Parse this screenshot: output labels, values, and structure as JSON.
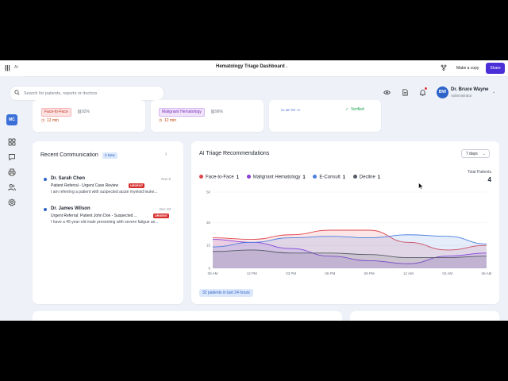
{
  "topbar": {
    "logo": "|||",
    "ai_label": "AI",
    "title": "Hematology Triage Dashboard",
    "title_caret": "⌄",
    "make_copy": "Make a copy",
    "share": "Share"
  },
  "sidebar": {
    "badge": "MC",
    "items": [
      "dashboard",
      "messages",
      "print",
      "patients",
      "settings"
    ]
  },
  "search": {
    "placeholder": "Search for patients, reports or doctors"
  },
  "user": {
    "initials": "BW",
    "name": "Dr. Bruce Wayne",
    "role": "Administrator",
    "caret": "⌄"
  },
  "top_cards": [
    {
      "tag": "Face-to-Face",
      "confidence": "92%",
      "time": "12 min"
    },
    {
      "tag": "Malignant Hematology",
      "confidence": "96%",
      "time": "12 min"
    },
    {
      "mini_tags": "SL  MF  ER  +2",
      "status": "Verified"
    }
  ],
  "communication": {
    "title": "Recent Communication",
    "new_badge": "2 New",
    "messages": [
      {
        "sender": "Dr. Sarah Chen",
        "date": "Nov 8",
        "subject": "Patient Referral - Urgent Case Review",
        "badge": "URGENT",
        "preview": "I am referring a patient with suspected acute myeloid leuke..."
      },
      {
        "sender": "Dr. James Wilson",
        "date": "Dec 20",
        "subject": "Urgent Referral: Patient John Doe - Suspected ...",
        "badge": "URGENT",
        "preview": "I have a 45-year-old male presenting with severe fatigue an..."
      }
    ]
  },
  "triage": {
    "title": "AI Triage Recommendations",
    "range": "7 days",
    "total_label": "Total Patients",
    "total_value": "4",
    "footer": "32 patients in last 24 hours",
    "legend": [
      {
        "name": "Face-to-Face",
        "count": "1",
        "color": "#e0464e"
      },
      {
        "name": "Malignant Hematology",
        "count": "1",
        "color": "#8b3fd9"
      },
      {
        "name": "E-Consult",
        "count": "1",
        "color": "#4a7fe0"
      },
      {
        "name": "Decline",
        "count": "1",
        "color": "#555b66"
      }
    ]
  },
  "chart_data": {
    "type": "area",
    "categories": [
      "09 AM",
      "12 PM",
      "03 PM",
      "06 PM",
      "09 PM",
      "12 AM",
      "03 AM",
      "06 AM"
    ],
    "y_ticks": [
      0,
      15,
      30,
      50
    ],
    "ylim": [
      0,
      50
    ],
    "series": [
      {
        "name": "Face-to-Face",
        "color": "#e0464e",
        "values": [
          20,
          19,
          22,
          25,
          25,
          17,
          12,
          15
        ]
      },
      {
        "name": "Malignant Hematology",
        "color": "#8b3fd9",
        "values": [
          19,
          17,
          13,
          8,
          5,
          3,
          8,
          10
        ]
      },
      {
        "name": "E-Consult",
        "color": "#4a7fe0",
        "values": [
          14,
          17,
          20,
          21,
          20,
          22,
          21,
          16
        ]
      },
      {
        "name": "Decline",
        "color": "#555b66",
        "values": [
          11,
          12,
          10,
          10,
          9,
          7,
          7,
          8
        ]
      }
    ]
  }
}
